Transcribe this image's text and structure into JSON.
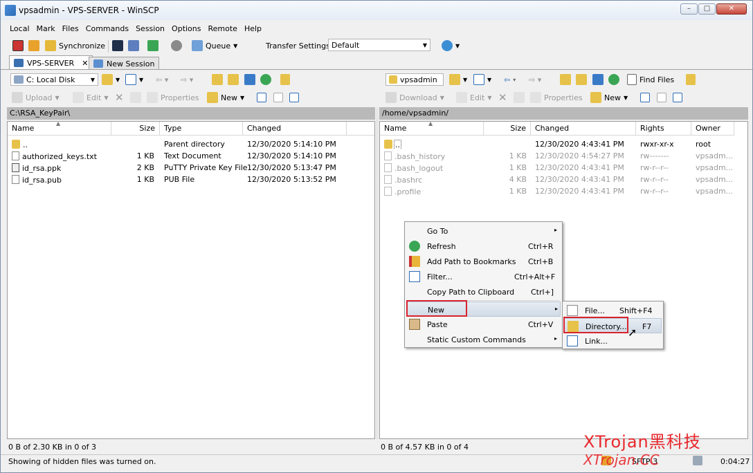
{
  "window": {
    "title": "vpsadmin - VPS-SERVER - WinSCP",
    "controls": [
      "–",
      "□",
      "✕"
    ]
  },
  "menubar": [
    "Local",
    "Mark",
    "Files",
    "Commands",
    "Session",
    "Options",
    "Remote",
    "Help"
  ],
  "toolbar1": {
    "synchronize": "Synchronize",
    "queue": "Queue",
    "transfer_label": "Transfer Settings",
    "transfer_value": "Default"
  },
  "tabs": [
    {
      "label": "VPS-SERVER",
      "close": "✕"
    },
    {
      "label": "New Session"
    }
  ],
  "left": {
    "drive": "C: Local Disk",
    "actions": {
      "upload": "Upload",
      "edit": "Edit",
      "properties": "Properties",
      "new": "New"
    },
    "path": "C:\\RSA_KeyPair\\",
    "columns": [
      "Name",
      "Size",
      "Type",
      "Changed"
    ],
    "rows": [
      {
        "name": "..",
        "size": "",
        "type": "Parent directory",
        "changed": "12/30/2020  5:14:10 PM"
      },
      {
        "name": "authorized_keys.txt",
        "size": "1 KB",
        "type": "Text Document",
        "changed": "12/30/2020  5:14:10 PM"
      },
      {
        "name": "id_rsa.ppk",
        "size": "2 KB",
        "type": "PuTTY Private Key File",
        "changed": "12/30/2020  5:13:47 PM"
      },
      {
        "name": "id_rsa.pub",
        "size": "1 KB",
        "type": "PUB File",
        "changed": "12/30/2020  5:13:52 PM"
      }
    ],
    "status": "0 B of 2.30 KB in 0 of 3"
  },
  "right": {
    "drive": "vpsadmin",
    "find": "Find Files",
    "actions": {
      "download": "Download",
      "edit": "Edit",
      "properties": "Properties",
      "new": "New"
    },
    "path": "/home/vpsadmin/",
    "columns": [
      "Name",
      "Size",
      "Changed",
      "Rights",
      "Owner"
    ],
    "rows": [
      {
        "name": "..",
        "size": "",
        "changed": "12/30/2020 4:43:41 PM",
        "rights": "rwxr-xr-x",
        "owner": "root"
      },
      {
        "name": ".bash_history",
        "size": "1 KB",
        "changed": "12/30/2020 4:54:27 PM",
        "rights": "rw-------",
        "owner": "vpsadm..."
      },
      {
        "name": ".bash_logout",
        "size": "1 KB",
        "changed": "12/30/2020 4:43:41 PM",
        "rights": "rw-r--r--",
        "owner": "vpsadm..."
      },
      {
        "name": ".bashrc",
        "size": "4 KB",
        "changed": "12/30/2020 4:43:41 PM",
        "rights": "rw-r--r--",
        "owner": "vpsadm..."
      },
      {
        "name": ".profile",
        "size": "1 KB",
        "changed": "12/30/2020 4:43:41 PM",
        "rights": "rw-r--r--",
        "owner": "vpsadm..."
      }
    ],
    "status": "0 B of 4.57 KB in 0 of 4"
  },
  "context_menu": [
    {
      "label": "Go To",
      "shortcut": "",
      "arrow": "▸"
    },
    {
      "label": "Refresh",
      "shortcut": "Ctrl+R"
    },
    {
      "label": "Add Path to Bookmarks",
      "shortcut": "Ctrl+B"
    },
    {
      "label": "Filter...",
      "shortcut": "Ctrl+Alt+F"
    },
    {
      "label": "Copy Path to Clipboard",
      "shortcut": "Ctrl+]"
    },
    {
      "label": "New",
      "shortcut": "",
      "arrow": "▸"
    },
    {
      "label": "Paste",
      "shortcut": "Ctrl+V"
    },
    {
      "label": "Static Custom Commands",
      "shortcut": "",
      "arrow": "▸"
    }
  ],
  "submenu": [
    {
      "label": "File...",
      "shortcut": "Shift+F4"
    },
    {
      "label": "Directory...",
      "shortcut": "F7"
    },
    {
      "label": "Link...",
      "shortcut": ""
    }
  ],
  "statusbar": {
    "message": "Showing of hidden files was turned on.",
    "protocol": "SFTP-3",
    "time": "0:04:27"
  },
  "watermark": {
    "line1": "XTrojan黑科技",
    "line2": "XTrojan.CC"
  }
}
